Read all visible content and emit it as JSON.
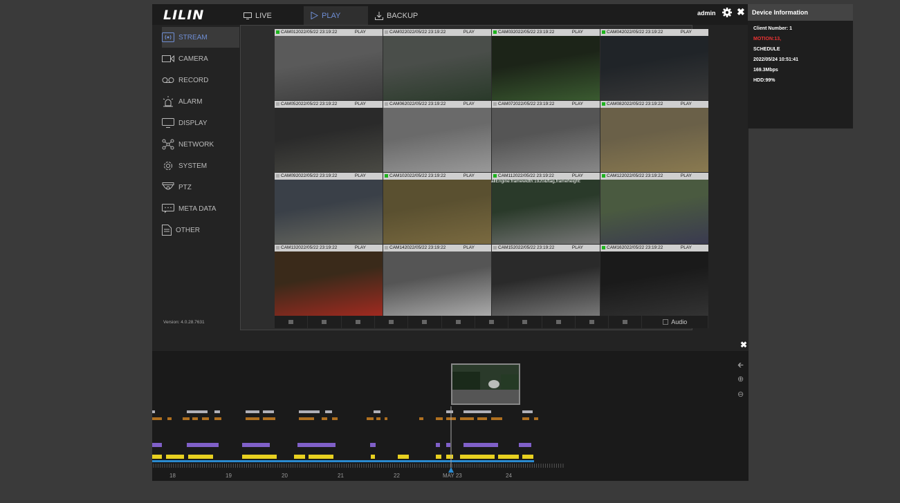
{
  "brand": "LILIN",
  "tabs": {
    "live": "LIVE",
    "play": "PLAY",
    "backup": "BACKUP"
  },
  "user": "admin",
  "sidebar": {
    "items": [
      {
        "label": "STREAM",
        "icon": "stream-icon"
      },
      {
        "label": "CAMERA",
        "icon": "camera-icon"
      },
      {
        "label": "RECORD",
        "icon": "record-icon"
      },
      {
        "label": "ALARM",
        "icon": "alarm-icon"
      },
      {
        "label": "DISPLAY",
        "icon": "display-icon"
      },
      {
        "label": "NETWORK",
        "icon": "network-icon"
      },
      {
        "label": "SYSTEM",
        "icon": "system-icon"
      },
      {
        "label": "PTZ",
        "icon": "ptz-icon"
      },
      {
        "label": "META DATA",
        "icon": "metadata-icon"
      },
      {
        "label": "OTHER",
        "icon": "other-icon"
      }
    ],
    "version": "Version: 4.0.28.7631"
  },
  "cameras": [
    {
      "name": "CAM01",
      "time": "2022/05/22 23:19:22",
      "status": "PLAY",
      "indicator": "green"
    },
    {
      "name": "CAM02",
      "time": "2022/05/22 23:19:22",
      "status": "PLAY",
      "indicator": "gray"
    },
    {
      "name": "CAM03",
      "time": "2022/05/22 23:19:22",
      "status": "PLAY",
      "indicator": "green"
    },
    {
      "name": "CAM04",
      "time": "2022/05/22 23:19:22",
      "status": "PLAY",
      "indicator": "green"
    },
    {
      "name": "CAM05",
      "time": "2022/05/22 23:19:22",
      "status": "PLAY",
      "indicator": "gray"
    },
    {
      "name": "CAM06",
      "time": "2022/05/22 23:19:22",
      "status": "PLAY",
      "indicator": "gray"
    },
    {
      "name": "CAM07",
      "time": "2022/05/22 23:19:22",
      "status": "PLAY",
      "indicator": "gray"
    },
    {
      "name": "CAM08",
      "time": "2022/05/22 23:19:22",
      "status": "PLAY",
      "indicator": "green"
    },
    {
      "name": "CAM09",
      "time": "2022/05/22 23:19:22",
      "status": "PLAY",
      "indicator": "gray"
    },
    {
      "name": "CAM10",
      "time": "2022/05/22 23:19:22",
      "status": "PLAY",
      "indicator": "green"
    },
    {
      "name": "CAM11",
      "time": "2022/05/22 23:19:22",
      "status": "PLAY",
      "indicator": "green"
    },
    {
      "name": "CAM12",
      "time": "2022/05/22 23:19:22",
      "status": "PLAY",
      "indicator": "green"
    },
    {
      "name": "CAM13",
      "time": "2022/05/22 23:19:22",
      "status": "PLAY",
      "indicator": "gray"
    },
    {
      "name": "CAM14",
      "time": "2022/05/22 23:19:22",
      "status": "PLAY",
      "indicator": "gray"
    },
    {
      "name": "CAM15",
      "time": "2022/05/22 23:19:22",
      "status": "PLAY",
      "indicator": "gray"
    },
    {
      "name": "CAM16",
      "time": "2022/05/22 23:19:22",
      "status": "PLAY",
      "indicator": "green"
    }
  ],
  "overlay_text": "allEngine:framewidth:1920&ftag,frameheight:",
  "controls": {
    "audio_label": "Audio"
  },
  "timeline": {
    "labels": [
      "18",
      "19",
      "20",
      "21",
      "22",
      "MAY 23",
      "24"
    ]
  },
  "device_info": {
    "title": "Device Information",
    "client_number": "Client Number: 1",
    "motion": "MOTION:13,",
    "schedule": "SCHEDULE",
    "datetime": "2022/05/24 10:51:41",
    "bitrate": "169.3Mbps",
    "hdd": "HDD:99%"
  },
  "colors": {
    "accent": "#6f8fd6",
    "alert": "#e33333",
    "track_yellow": "#e8d020",
    "track_purple": "#8060c8",
    "track_orange": "#b07020",
    "track_gray": "#b0b0b8",
    "track_blue": "#2a8ad0"
  }
}
